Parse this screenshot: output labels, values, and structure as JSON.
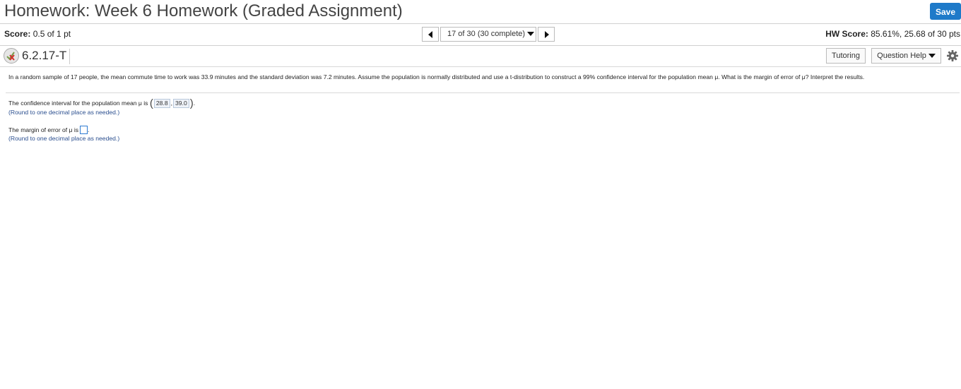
{
  "header": {
    "title": "Homework: Week 6 Homework (Graded Assignment)",
    "save_label": "Save"
  },
  "score_bar": {
    "score_label": "Score:",
    "score_value": "0.5 of 1 pt",
    "question_nav": "17 of 30 (30 complete)",
    "hw_score_label": "HW Score:",
    "hw_score_value": "85.61%, 25.68 of 30 pts"
  },
  "question_bar": {
    "question_id": "6.2.17-T",
    "tutoring_label": "Tutoring",
    "question_help_label": "Question Help"
  },
  "question": {
    "text": "In a random sample of 17 people, the mean commute time to work was 33.9 minutes and the standard deviation was 7.2 minutes. Assume the population is normally distributed and use a t-distribution to construct a 99% confidence interval for the population mean μ. What is the margin of error of μ? Interpret the results."
  },
  "parts": {
    "ci_prefix": "The confidence interval for the population mean μ is",
    "ci_lower": "28.8",
    "ci_separator": ",",
    "ci_upper": "39.0",
    "ci_hint": "(Round to one decimal place as needed.)",
    "moe_prefix": "The margin of error of μ is",
    "moe_value": "",
    "moe_hint": "(Round to one decimal place as needed.)"
  },
  "colors": {
    "accent": "#1e7ac9",
    "hint": "#2b4f8f"
  }
}
